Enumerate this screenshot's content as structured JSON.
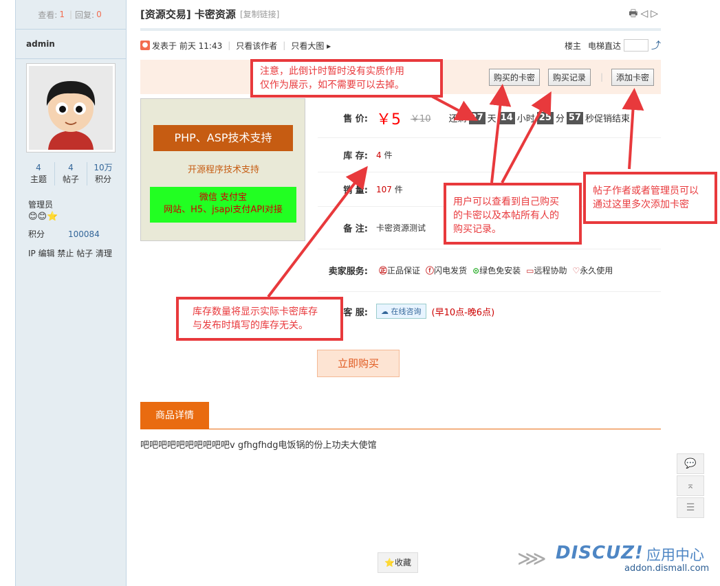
{
  "sidebar": {
    "views_label": "查看:",
    "views_value": "1",
    "sep": "|",
    "replies_label": "回复:",
    "replies_value": "0",
    "username": "admin",
    "stats": [
      {
        "value": "4",
        "label": "主题"
      },
      {
        "value": "4",
        "label": "帖子"
      },
      {
        "value": "10万",
        "label": "积分"
      }
    ],
    "role": "管理员",
    "medals": "😊😊⭐",
    "score_label": "积分",
    "score_value": "100084",
    "admin_ops": "IP 编辑 禁止 帖子 清理"
  },
  "thread": {
    "title": "[资源交易] 卡密资源",
    "copy_link": "[复制链接]",
    "icons": "🖶◁▷",
    "posted": "发表于 前天 11:43",
    "only_author": "只看该作者",
    "only_big_images": "只看大图 ▸",
    "floor_owner": "楼主",
    "elevator": "电梯直达",
    "elevator_icon": "⤴"
  },
  "banner": {
    "my_cards": "购买的卡密",
    "purchase_records": "购买记录",
    "sep": "|",
    "add_cards": "添加卡密"
  },
  "product_image": {
    "line1": "PHP、ASP技术支持",
    "line2": "开源程序技术支持",
    "line3": "微信 支付宝",
    "line4": "网站、H5、jsapi支付API对接"
  },
  "product": {
    "price_label": "售 价:",
    "price": "￥5",
    "old_price": "￥10",
    "countdown_prefix": "还剩",
    "days": "27",
    "days_unit": "天",
    "hours": "14",
    "hours_unit": "小时",
    "minutes": "25",
    "minutes_unit": "分",
    "seconds": "57",
    "countdown_suffix": "秒促销结束",
    "stock_label": "库 存:",
    "stock_value": "4",
    "stock_unit": "件",
    "sold_label": "销 量:",
    "sold_value": "107",
    "sold_unit": "件",
    "note_label": "备 注:",
    "note_value": "卡密资源测试",
    "service_label": "卖家服务:",
    "services": [
      "正品保证",
      "闪电发货",
      "绿色免安装",
      "远程协助",
      "永久使用"
    ],
    "service_icons": [
      "㊣",
      "ⓕ",
      "⊙",
      "▭",
      "♡"
    ],
    "contact_label": "客 服:",
    "consult": "☁ 在线咨询",
    "consult_hours": "(早10点-晚6点)",
    "buy_now": "立即购买"
  },
  "details": {
    "tab": "商品详情",
    "text": "吧吧吧吧吧吧吧吧吧吧v gfhgfhdg电饭锅的份上功夫大使馆"
  },
  "footer": {
    "favorite": "⭐收藏",
    "float_icons": [
      "💬",
      "⌅",
      "☰"
    ],
    "logo_main": "DISCUZ!",
    "logo_cn": "应用中心",
    "logo_url": "addon.dismall.com",
    "logo_wing": "⋙"
  },
  "annotations": {
    "countdown_note_1": "注意，此倒计时暂时没有实质作用",
    "countdown_note_2": "仅作为展示，如不需要可以去掉。",
    "records_note_1": "用户可以查看到自己购买",
    "records_note_2": "的卡密以及本帖所有人的",
    "records_note_3": "购买记录。",
    "add_note_1": "帖子作者或者管理员可以",
    "add_note_2": "通过这里多次添加卡密",
    "stock_note_1": "库存数量将显示实际卡密库存",
    "stock_note_2": "与发布时填写的库存无关。"
  }
}
